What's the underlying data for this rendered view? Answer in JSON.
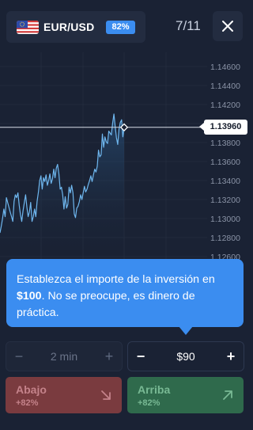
{
  "header": {
    "asset": "EUR/USD",
    "flag_icon": "eu-us-flag-icon",
    "payout": "82%",
    "step": "7/11",
    "close_icon": "close-icon"
  },
  "chart_data": {
    "type": "line",
    "y_ticks": [
      "1.14600",
      "1.14400",
      "1.14200",
      "1.14000",
      "1.13800",
      "1.13600",
      "1.13400",
      "1.13200",
      "1.13000",
      "1.12800",
      "1.12600"
    ],
    "ylim": [
      1.1255,
      1.1475
    ],
    "current_price": "1.13960",
    "current_value": 1.1396,
    "series": [
      {
        "values": [
          1.1285,
          1.1292,
          1.13,
          1.131,
          1.1302,
          1.1322,
          1.1317,
          1.1312,
          1.1307,
          1.1302,
          1.1297,
          1.1318,
          1.1325,
          1.1322,
          1.1327,
          1.1314,
          1.1304,
          1.1297,
          1.1308,
          1.1317,
          1.1325,
          1.1312,
          1.1302,
          1.1307,
          1.1317,
          1.1297,
          1.1302,
          1.131,
          1.1302,
          1.1318,
          1.1328,
          1.134,
          1.1345,
          1.1331,
          1.1343,
          1.1339,
          1.1346,
          1.1335,
          1.134,
          1.1347,
          1.1337,
          1.1342,
          1.1352,
          1.1343,
          1.1353,
          1.1357,
          1.1347,
          1.1331,
          1.1333,
          1.1325,
          1.131,
          1.1323,
          1.1311,
          1.1315,
          1.1333,
          1.1327,
          1.1335,
          1.1327,
          1.1305,
          1.1301,
          1.1311,
          1.1313,
          1.1318,
          1.1325,
          1.132,
          1.1327,
          1.1334,
          1.1328,
          1.1331,
          1.1336,
          1.134,
          1.1345,
          1.1339,
          1.1346,
          1.1352,
          1.1349,
          1.1355,
          1.1372,
          1.1365,
          1.1367,
          1.1389,
          1.1375,
          1.1386,
          1.1381,
          1.1379,
          1.1392,
          1.139,
          1.1388,
          1.14,
          1.141,
          1.1397,
          1.1385,
          1.1378,
          1.1394,
          1.1401,
          1.1404,
          1.1386,
          1.1396
        ]
      }
    ]
  },
  "tooltip": {
    "line1": "Establezca el importe de la inversión en",
    "bold": "$100",
    "line2": ". No se preocupe, es dinero de práctica."
  },
  "controls": {
    "time": {
      "minus": "−",
      "value": "2 min",
      "plus": "+"
    },
    "amount": {
      "minus": "−",
      "value": "$90",
      "plus": "+"
    }
  },
  "trade": {
    "down": {
      "label": "Abajo",
      "payout": "+82%",
      "icon": "arrow-down-right-icon"
    },
    "up": {
      "label": "Arriba",
      "payout": "+82%",
      "icon": "arrow-up-right-icon"
    }
  },
  "colors": {
    "background": "#1a2234",
    "accent": "#3b8df0",
    "line": "#6fb7ef",
    "down": "#7a3b3f",
    "up": "#2f6a4c"
  }
}
